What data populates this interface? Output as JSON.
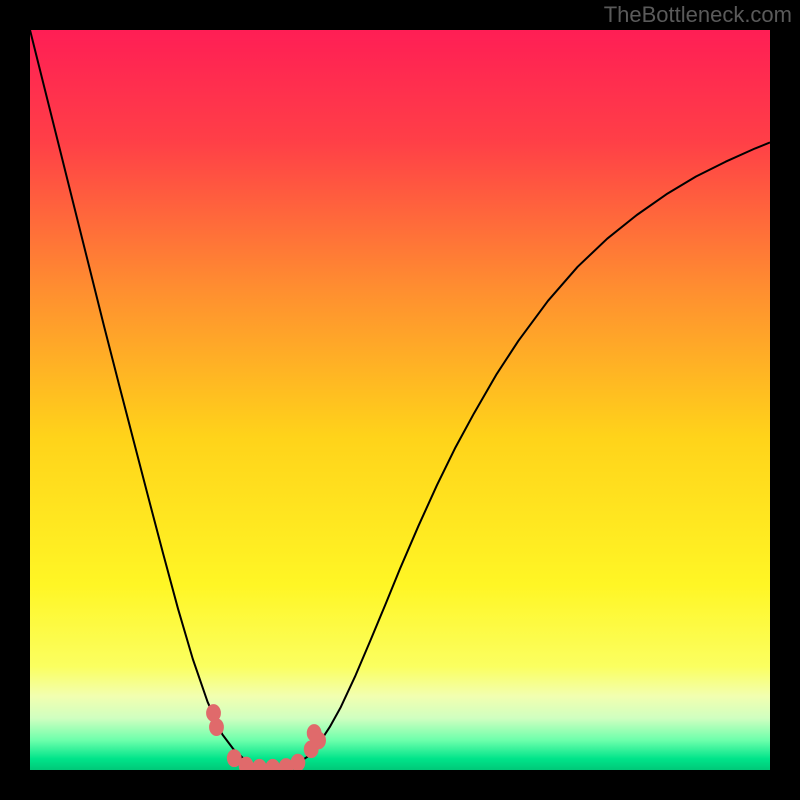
{
  "watermark": "TheBottleneck.com",
  "chart_data": {
    "type": "line",
    "title": "",
    "xlabel": "",
    "ylabel": "",
    "xlim": [
      0,
      1
    ],
    "ylim": [
      0,
      1
    ],
    "grid": false,
    "legend": false,
    "background_gradient": {
      "stops": [
        {
          "pos": 0.0,
          "color": "#ff1e55"
        },
        {
          "pos": 0.15,
          "color": "#ff3f47"
        },
        {
          "pos": 0.35,
          "color": "#ff8e30"
        },
        {
          "pos": 0.55,
          "color": "#ffd31a"
        },
        {
          "pos": 0.75,
          "color": "#fff625"
        },
        {
          "pos": 0.86,
          "color": "#fbff60"
        },
        {
          "pos": 0.9,
          "color": "#f2ffb0"
        },
        {
          "pos": 0.93,
          "color": "#d0ffc0"
        },
        {
          "pos": 0.96,
          "color": "#6cffab"
        },
        {
          "pos": 0.985,
          "color": "#00e48a"
        },
        {
          "pos": 1.0,
          "color": "#00c878"
        }
      ]
    },
    "series": [
      {
        "name": "curve",
        "x": [
          0.0,
          0.02,
          0.04,
          0.06,
          0.08,
          0.1,
          0.12,
          0.14,
          0.16,
          0.18,
          0.2,
          0.22,
          0.24,
          0.26,
          0.275,
          0.29,
          0.3,
          0.31,
          0.32,
          0.33,
          0.34,
          0.35,
          0.36,
          0.375,
          0.39,
          0.405,
          0.42,
          0.44,
          0.46,
          0.48,
          0.5,
          0.525,
          0.55,
          0.575,
          0.6,
          0.63,
          0.66,
          0.7,
          0.74,
          0.78,
          0.82,
          0.86,
          0.9,
          0.94,
          0.98,
          1.0
        ],
        "y": [
          1.0,
          0.92,
          0.84,
          0.76,
          0.68,
          0.6,
          0.522,
          0.445,
          0.368,
          0.292,
          0.218,
          0.15,
          0.092,
          0.048,
          0.028,
          0.014,
          0.008,
          0.004,
          0.002,
          0.002,
          0.002,
          0.004,
          0.008,
          0.018,
          0.035,
          0.058,
          0.085,
          0.128,
          0.175,
          0.223,
          0.272,
          0.33,
          0.385,
          0.436,
          0.482,
          0.534,
          0.58,
          0.634,
          0.68,
          0.718,
          0.75,
          0.778,
          0.802,
          0.822,
          0.84,
          0.848
        ]
      }
    ],
    "markers": {
      "name": "bottom-points",
      "color": "#e06a6b",
      "radius_x": 0.01,
      "radius_y": 0.012,
      "points": [
        {
          "x": 0.248,
          "y": 0.077
        },
        {
          "x": 0.252,
          "y": 0.058
        },
        {
          "x": 0.276,
          "y": 0.016
        },
        {
          "x": 0.292,
          "y": 0.006
        },
        {
          "x": 0.31,
          "y": 0.003
        },
        {
          "x": 0.328,
          "y": 0.003
        },
        {
          "x": 0.346,
          "y": 0.004
        },
        {
          "x": 0.362,
          "y": 0.01
        },
        {
          "x": 0.38,
          "y": 0.028
        },
        {
          "x": 0.384,
          "y": 0.05
        },
        {
          "x": 0.39,
          "y": 0.04
        }
      ]
    }
  }
}
